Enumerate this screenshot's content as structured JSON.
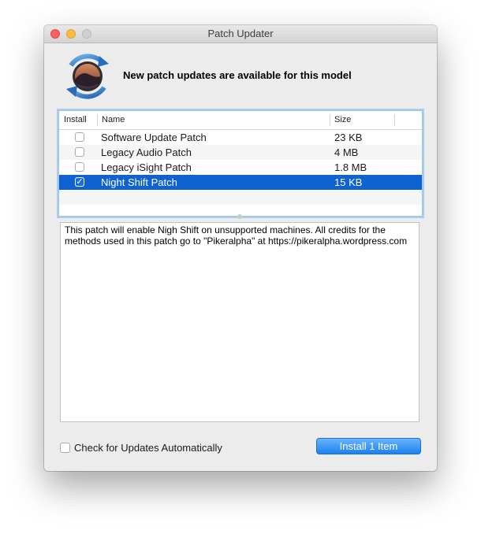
{
  "window": {
    "title": "Patch Updater"
  },
  "header": {
    "headline": "New patch updates are available for this model"
  },
  "table": {
    "columns": {
      "install": "Install",
      "name": "Name",
      "size": "Size"
    },
    "rows": [
      {
        "name": "Software Update Patch",
        "size": "23 KB",
        "checked": false
      },
      {
        "name": "Legacy Audio Patch",
        "size": "4 MB",
        "checked": false
      },
      {
        "name": "Legacy iSight Patch",
        "size": "1.8 MB",
        "checked": false
      },
      {
        "name": "Night Shift Patch",
        "size": "15 KB",
        "checked": true,
        "selected": true
      }
    ]
  },
  "description": "This patch will enable Nigh Shift on unsupported machines. All credits for the methods used in this patch go to \"Pikeralpha\" at https://pikeralpha.wordpress.com",
  "footer": {
    "auto_update_label": "Check for Updates Automatically",
    "auto_update_checked": false,
    "install_button": "Install 1 Item"
  },
  "icons": {
    "app": "macos-mojave-refresh-icon",
    "checkmark": "✓"
  },
  "colors": {
    "selection": "#0f63d1",
    "accent": "#1a81f2",
    "close": "#fc605b",
    "minimize": "#fdbc40"
  }
}
